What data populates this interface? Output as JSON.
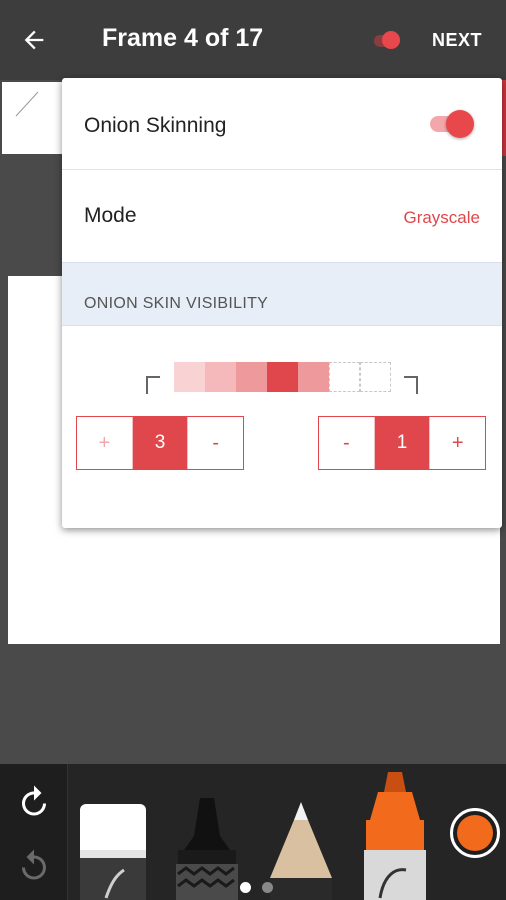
{
  "appbar": {
    "title": "Frame 4 of 17",
    "next_label": "NEXT",
    "back_icon": "arrow-left-icon"
  },
  "panel": {
    "onion_label": "Onion Skinning",
    "onion_enabled": true,
    "mode_label": "Mode",
    "mode_value": "Grayscale",
    "section_title": "ONION SKIN VISIBILITY",
    "before_frames": "3",
    "after_frames": "1",
    "plus": "+",
    "minus": "-"
  },
  "colors": {
    "accent": "#e0474c",
    "selected_color": "#f26b1d"
  },
  "toolbar": {
    "tools": [
      "eraser",
      "marker",
      "pencil",
      "highlighter"
    ],
    "page_indicator": {
      "count": 2,
      "active": 0
    }
  }
}
